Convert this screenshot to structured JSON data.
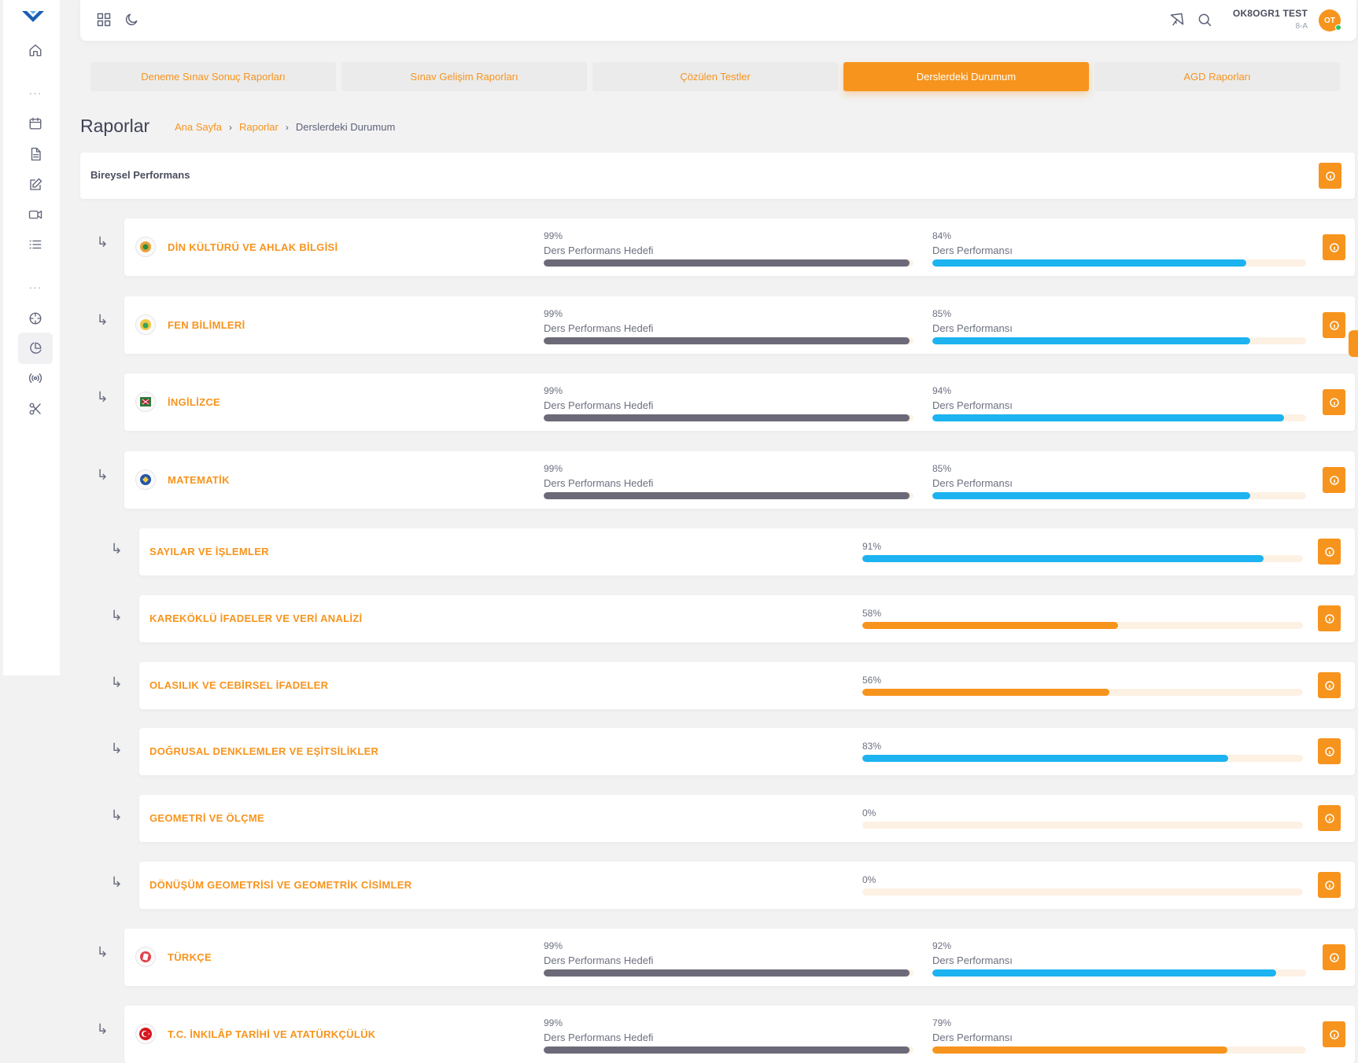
{
  "header": {
    "user_name": "OK8OGR1 TEST",
    "user_class": "8-A",
    "avatar_initials": "OT"
  },
  "tabs": [
    {
      "label": "Deneme Sınav Sonuç Raporları",
      "active": false
    },
    {
      "label": "Sınav Gelişim Raporları",
      "active": false
    },
    {
      "label": "Çözülen Testler",
      "active": false
    },
    {
      "label": "Derslerdeki Durumum",
      "active": true
    },
    {
      "label": "AGD Raporları",
      "active": false
    }
  ],
  "page": {
    "title": "Raporlar",
    "breadcrumb": [
      "Ana Sayfa",
      "Raporlar",
      "Derslerdeki Durumum"
    ]
  },
  "performance": {
    "title": "Bireysel Performans"
  },
  "labels": {
    "target": "Ders Performans Hedefi",
    "actual": "Ders Performansı"
  },
  "subjects": [
    {
      "name": "DİN KÜLTÜRÜ VE AHLAK BİLGİSİ",
      "target_pct": "99%",
      "target": 99,
      "actual_pct": "84%",
      "actual": 84,
      "color": "#1cb3f0",
      "icon": "din-icon"
    },
    {
      "name": "FEN BİLİMLERİ",
      "target_pct": "99%",
      "target": 99,
      "actual_pct": "85%",
      "actual": 85,
      "color": "#1cb3f0",
      "icon": "fen-icon"
    },
    {
      "name": "İNGİLİZCE",
      "target_pct": "99%",
      "target": 99,
      "actual_pct": "94%",
      "actual": 94,
      "color": "#1cb3f0",
      "icon": "ingilizce-icon"
    },
    {
      "name": "MATEMATİK",
      "target_pct": "99%",
      "target": 99,
      "actual_pct": "85%",
      "actual": 85,
      "color": "#1cb3f0",
      "icon": "matematik-icon"
    }
  ],
  "topics": [
    {
      "name": "SAYILAR VE İŞLEMLER",
      "pct": "91%",
      "value": 91,
      "color": "#1cb3f0"
    },
    {
      "name": "KAREKÖKLÜ İFADELER VE VERİ ANALİZİ",
      "pct": "58%",
      "value": 58,
      "color": "#f7941d"
    },
    {
      "name": "OLASILIK VE CEBİRSEL İFADELER",
      "pct": "56%",
      "value": 56,
      "color": "#f7941d"
    },
    {
      "name": "DOĞRUSAL DENKLEMLER VE EŞİTSİLİKLER",
      "pct": "83%",
      "value": 83,
      "color": "#1cb3f0"
    },
    {
      "name": "GEOMETRİ VE ÖLÇME",
      "pct": "0%",
      "value": 0,
      "color": "#1cb3f0"
    },
    {
      "name": "DÖNÜŞÜM GEOMETRİSİ VE GEOMETRİK CİSİMLER",
      "pct": "0%",
      "value": 0,
      "color": "#1cb3f0"
    }
  ],
  "subjects_after": [
    {
      "name": "TÜRKÇE",
      "target_pct": "99%",
      "target": 99,
      "actual_pct": "92%",
      "actual": 92,
      "color": "#1cb3f0",
      "icon": "turkce-icon"
    },
    {
      "name": "T.C. İNKILÂP TARİHİ VE ATATÜRKÇÜLÜK",
      "target_pct": "99%",
      "target": 99,
      "actual_pct": "79%",
      "actual": 79,
      "color": "#f7941d",
      "icon": "inkilap-icon"
    }
  ]
}
